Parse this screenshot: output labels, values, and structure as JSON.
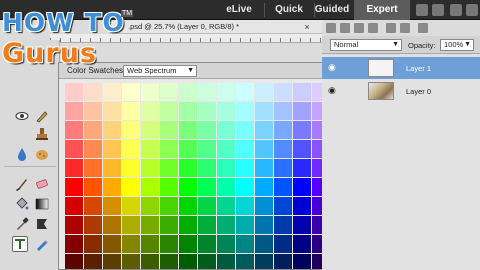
{
  "topbar": {
    "modes": [
      {
        "label": "eLive",
        "active": false
      },
      {
        "label": "Quick",
        "active": false
      },
      {
        "label": "Guided",
        "active": false
      },
      {
        "label": "Expert",
        "active": true
      }
    ]
  },
  "document": {
    "tab_title": ".psd @ 25.7% (Layer 0, RGB/8) *",
    "close_glyph": "×"
  },
  "logo": {
    "line1": "HOW TO",
    "line2": "Gurus",
    "mark": "TM"
  },
  "swatches_panel": {
    "title": "Color Swatches",
    "library": "Web Spectrum",
    "menu_icon": "panel-menu-icon"
  },
  "layers_panel": {
    "blend_mode": "Normal",
    "opacity_label": "Opacity:",
    "opacity_value": "100%",
    "layers": [
      {
        "name": "Layer 1",
        "selected": true
      },
      {
        "name": "Layer 0",
        "selected": false
      }
    ]
  },
  "toolbox": {
    "tools": [
      "eye-icon",
      "quick-selection-icon",
      "stamp-icon",
      "blur-drop-icon",
      "sponge-icon",
      "brush-icon",
      "eraser-icon",
      "paint-bucket-icon",
      "gradient-icon",
      "eyedropper-icon",
      "shape-icon",
      "type-icon",
      "pencil-icon"
    ]
  },
  "colors": {
    "accent": "#6f9fd8",
    "logo_blue": "#3f8fd8",
    "logo_orange": "#f07c1a"
  }
}
